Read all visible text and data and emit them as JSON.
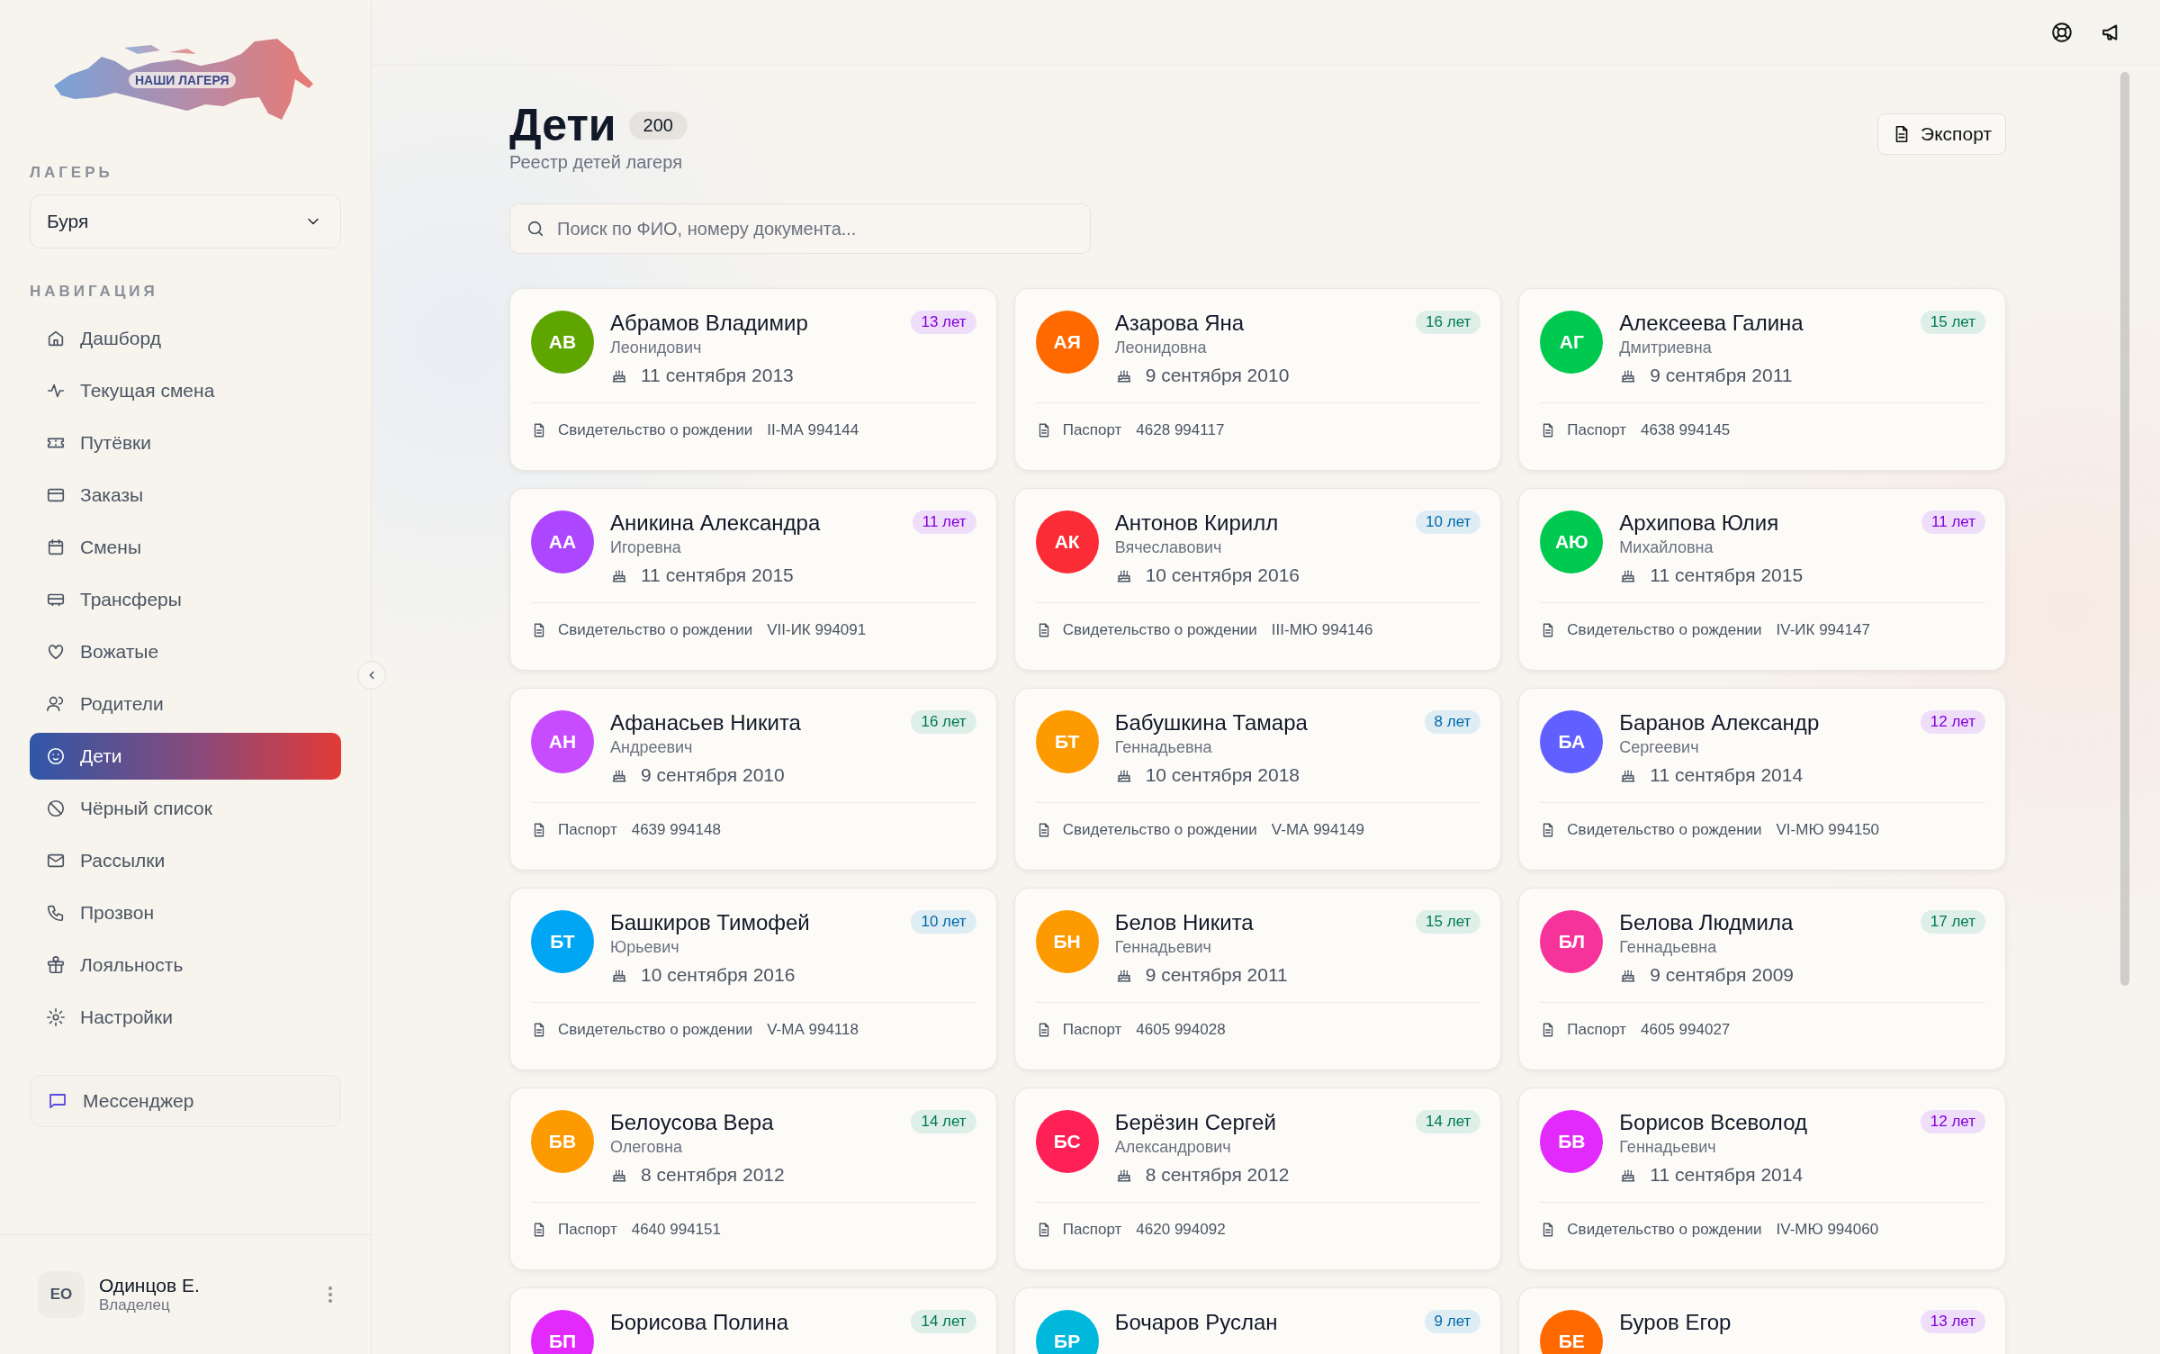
{
  "logo": {
    "text": "НАШИ ЛАГЕРЯ"
  },
  "camp": {
    "label": "ЛАГЕРЬ",
    "value": "Буря"
  },
  "navigation": {
    "label": "НАВИГАЦИЯ",
    "items": [
      {
        "label": "Дашборд",
        "selected": false
      },
      {
        "label": "Текущая смена",
        "selected": false
      },
      {
        "label": "Путёвки",
        "selected": false
      },
      {
        "label": "Заказы",
        "selected": false
      },
      {
        "label": "Смены",
        "selected": false
      },
      {
        "label": "Трансферы",
        "selected": false
      },
      {
        "label": "Вожатые",
        "selected": false
      },
      {
        "label": "Родители",
        "selected": false
      },
      {
        "label": "Дети",
        "selected": true
      },
      {
        "label": "Чёрный список",
        "selected": false
      },
      {
        "label": "Рассылки",
        "selected": false
      },
      {
        "label": "Прозвон",
        "selected": false
      },
      {
        "label": "Лояльность",
        "selected": false
      },
      {
        "label": "Настройки",
        "selected": false
      }
    ]
  },
  "messenger": {
    "label": "Мессенджер"
  },
  "user": {
    "initials": "ЕО",
    "name": "Одинцов Е.",
    "role": "Владелец"
  },
  "page": {
    "title": "Дети",
    "count": "200",
    "subtitle": "Реестр детей лагеря",
    "export_button": "Экспорт"
  },
  "search": {
    "placeholder": "Поиск по ФИО, номеру документа..."
  },
  "children": [
    {
      "initials": "АВ",
      "color": "#5ea500",
      "name": "Абрамов Владимир",
      "patronymic": "Леонидович",
      "birthday": "11 сентября 2013",
      "document_type": "Свидетельство о рождении",
      "document_number": "II-МА 994144",
      "age": {
        "text": "13 лет",
        "color": "#8200db"
      }
    },
    {
      "initials": "АЯ",
      "color": "#ff6900",
      "name": "Азарова Яна",
      "patronymic": "Леонидовна",
      "birthday": "9 сентября 2010",
      "document_type": "Паспорт",
      "document_number": "4628 994117",
      "age": {
        "text": "16 лет",
        "color": "#007a55"
      }
    },
    {
      "initials": "АГ",
      "color": "#00c950",
      "name": "Алексеева Галина",
      "patronymic": "Дмитриевна",
      "birthday": "9 сентября 2011",
      "document_type": "Паспорт",
      "document_number": "4638 994145",
      "age": {
        "text": "15 лет",
        "color": "#007a55"
      }
    },
    {
      "initials": "АА",
      "color": "#ad46ff",
      "name": "Аникина Александра",
      "patronymic": "Игоревна",
      "birthday": "11 сентября 2015",
      "document_type": "Свидетельство о рождении",
      "document_number": "VII-ИК 994091",
      "age": {
        "text": "11 лет",
        "color": "#8200db"
      }
    },
    {
      "initials": "АК",
      "color": "#fb2c36",
      "name": "Антонов Кирилл",
      "patronymic": "Вячеславович",
      "birthday": "10 сентября 2016",
      "document_type": "Свидетельство о рождении",
      "document_number": "III-МЮ 994146",
      "age": {
        "text": "10 лет",
        "color": "#0069a8"
      }
    },
    {
      "initials": "АЮ",
      "color": "#00c950",
      "name": "Архипова Юлия",
      "patronymic": "Михайловна",
      "birthday": "11 сентября 2015",
      "document_type": "Свидетельство о рождении",
      "document_number": "IV-ИК 994147",
      "age": {
        "text": "11 лет",
        "color": "#8200db"
      }
    },
    {
      "initials": "АН",
      "color": "#c74bff",
      "name": "Афанасьев Никита",
      "patronymic": "Андреевич",
      "birthday": "9 сентября 2010",
      "document_type": "Паспорт",
      "document_number": "4639 994148",
      "age": {
        "text": "16 лет",
        "color": "#007a55"
      }
    },
    {
      "initials": "БТ",
      "color": "#fd9a00",
      "name": "Бабушкина Тамара",
      "patronymic": "Геннадьевна",
      "birthday": "10 сентября 2018",
      "document_type": "Свидетельство о рождении",
      "document_number": "V-МА 994149",
      "age": {
        "text": "8 лет",
        "color": "#0069a8"
      }
    },
    {
      "initials": "БА",
      "color": "#615fff",
      "name": "Баранов Александр",
      "patronymic": "Сергеевич",
      "birthday": "11 сентября 2014",
      "document_type": "Свидетельство о рождении",
      "document_number": "VI-МЮ 994150",
      "age": {
        "text": "12 лет",
        "color": "#8200db"
      }
    },
    {
      "initials": "БТ",
      "color": "#00a6f4",
      "name": "Башкиров Тимофей",
      "patronymic": "Юрьевич",
      "birthday": "10 сентября 2016",
      "document_type": "Свидетельство о рождении",
      "document_number": "V-МА 994118",
      "age": {
        "text": "10 лет",
        "color": "#0069a8"
      }
    },
    {
      "initials": "БН",
      "color": "#fd9a00",
      "name": "Белов Никита",
      "patronymic": "Геннадьевич",
      "birthday": "9 сентября 2011",
      "document_type": "Паспорт",
      "document_number": "4605 994028",
      "age": {
        "text": "15 лет",
        "color": "#007a55"
      }
    },
    {
      "initials": "БЛ",
      "color": "#f6339a",
      "name": "Белова Людмила",
      "patronymic": "Геннадьевна",
      "birthday": "9 сентября 2009",
      "document_type": "Паспорт",
      "document_number": "4605 994027",
      "age": {
        "text": "17 лет",
        "color": "#007a55"
      }
    },
    {
      "initials": "БВ",
      "color": "#fd9a00",
      "name": "Белоусова Вера",
      "patronymic": "Олеговна",
      "birthday": "8 сентября 2012",
      "document_type": "Паспорт",
      "document_number": "4640 994151",
      "age": {
        "text": "14 лет",
        "color": "#007a55"
      }
    },
    {
      "initials": "БС",
      "color": "#ff2056",
      "name": "Берёзин Сергей",
      "patronymic": "Александрович",
      "birthday": "8 сентября 2012",
      "document_type": "Паспорт",
      "document_number": "4620 994092",
      "age": {
        "text": "14 лет",
        "color": "#007a55"
      }
    },
    {
      "initials": "БВ",
      "color": "#e12afb",
      "name": "Борисов Всеволод",
      "patronymic": "Геннадьевич",
      "birthday": "11 сентября 2014",
      "document_type": "Свидетельство о рождении",
      "document_number": "IV-МЮ 994060",
      "age": {
        "text": "12 лет",
        "color": "#8200db"
      }
    },
    {
      "initials": "БП",
      "color": "#e12afb",
      "name": "Борисова Полина",
      "age": {
        "text": "14 лет",
        "color": "#007a55"
      }
    },
    {
      "initials": "БР",
      "color": "#00b8db",
      "name": "Бочаров Руслан",
      "age": {
        "text": "9 лет",
        "color": "#0069a8"
      }
    },
    {
      "initials": "БЕ",
      "color": "#ff6900",
      "name": "Буров Егор",
      "age": {
        "text": "13 лет",
        "color": "#8200db"
      }
    }
  ]
}
